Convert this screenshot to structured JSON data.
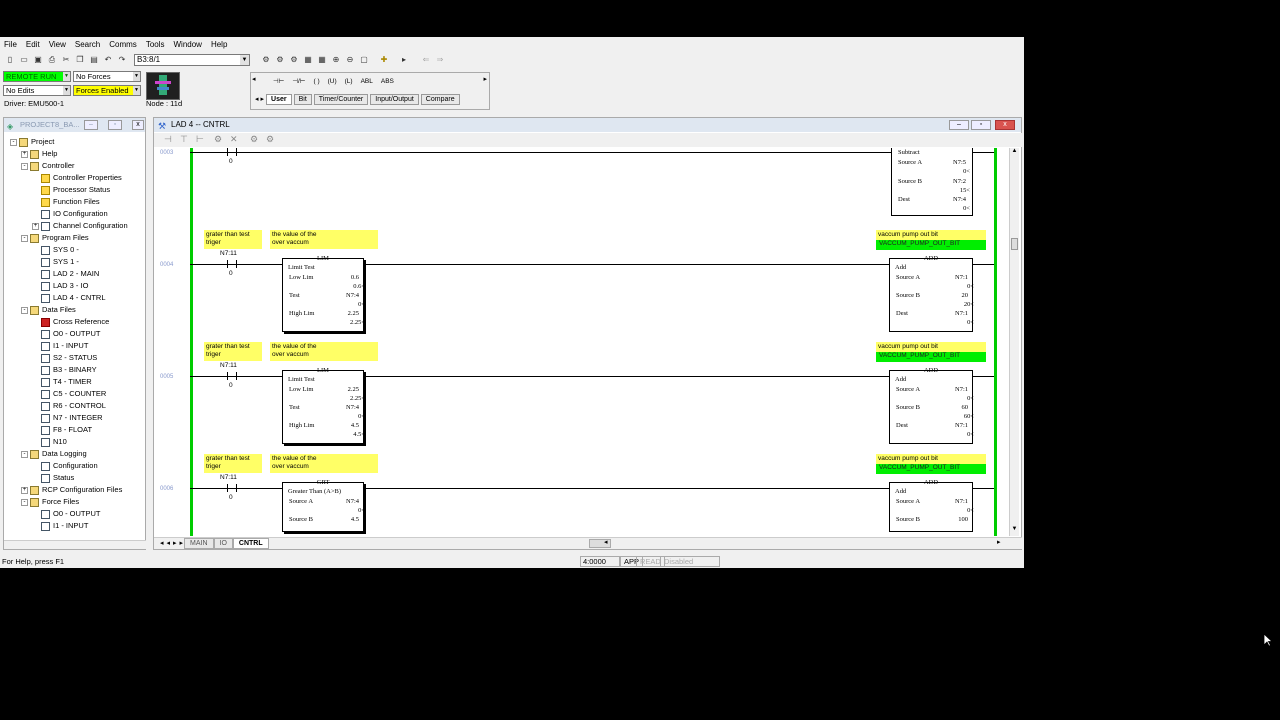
{
  "menu": [
    "File",
    "Edit",
    "View",
    "Search",
    "Comms",
    "Tools",
    "Window",
    "Help"
  ],
  "toolbar": {
    "address_combo": "B3:8/1"
  },
  "status_panel": {
    "mode": "REMOTE RUN",
    "forces": "No Forces",
    "edits": "No Edits",
    "forces_enabled": "Forces Enabled",
    "driver": "Driver: EMU500-1",
    "node": "Node : 11d"
  },
  "instruction_tabs": [
    "User",
    "Bit",
    "Timer/Counter",
    "Input/Output",
    "Compare"
  ],
  "instruction_row1": [
    "⊣⊢",
    "⊣/⊢",
    "( )",
    "(U)",
    "(L)",
    "ABL",
    "ABS"
  ],
  "project": {
    "title": "PROJECT8_BA...",
    "tree": [
      {
        "label": "Project",
        "lvl": 0,
        "icon": "folder",
        "exp": "-"
      },
      {
        "label": "Help",
        "lvl": 1,
        "icon": "folder",
        "exp": "+"
      },
      {
        "label": "Controller",
        "lvl": 1,
        "icon": "folder",
        "exp": "-"
      },
      {
        "label": "Controller Properties",
        "lvl": 2,
        "icon": "tool"
      },
      {
        "label": "Processor Status",
        "lvl": 2,
        "icon": "tool"
      },
      {
        "label": "Function Files",
        "lvl": 2,
        "icon": "tool"
      },
      {
        "label": "IO Configuration",
        "lvl": 2,
        "icon": "doc"
      },
      {
        "label": "Channel Configuration",
        "lvl": 2,
        "icon": "doc",
        "exp": "+"
      },
      {
        "label": "Program Files",
        "lvl": 1,
        "icon": "folder",
        "exp": "-"
      },
      {
        "label": "SYS 0 -",
        "lvl": 2,
        "icon": "doc"
      },
      {
        "label": "SYS 1 -",
        "lvl": 2,
        "icon": "doc"
      },
      {
        "label": "LAD 2 - MAIN",
        "lvl": 2,
        "icon": "doc"
      },
      {
        "label": "LAD 3 - IO",
        "lvl": 2,
        "icon": "doc"
      },
      {
        "label": "LAD 4 - CNTRL",
        "lvl": 2,
        "icon": "doc"
      },
      {
        "label": "Data Files",
        "lvl": 1,
        "icon": "folder",
        "exp": "-"
      },
      {
        "label": "Cross Reference",
        "lvl": 2,
        "icon": "red"
      },
      {
        "label": "O0 - OUTPUT",
        "lvl": 2,
        "icon": "doc"
      },
      {
        "label": "I1 - INPUT",
        "lvl": 2,
        "icon": "doc"
      },
      {
        "label": "S2 - STATUS",
        "lvl": 2,
        "icon": "doc"
      },
      {
        "label": "B3 - BINARY",
        "lvl": 2,
        "icon": "doc"
      },
      {
        "label": "T4 - TIMER",
        "lvl": 2,
        "icon": "doc"
      },
      {
        "label": "C5 - COUNTER",
        "lvl": 2,
        "icon": "doc"
      },
      {
        "label": "R6 - CONTROL",
        "lvl": 2,
        "icon": "doc"
      },
      {
        "label": "N7 - INTEGER",
        "lvl": 2,
        "icon": "doc"
      },
      {
        "label": "F8 - FLOAT",
        "lvl": 2,
        "icon": "doc"
      },
      {
        "label": "N10",
        "lvl": 2,
        "icon": "doc"
      },
      {
        "label": "Data Logging",
        "lvl": 1,
        "icon": "folder",
        "exp": "-"
      },
      {
        "label": "Configuration",
        "lvl": 2,
        "icon": "doc"
      },
      {
        "label": "Status",
        "lvl": 2,
        "icon": "doc"
      },
      {
        "label": "RCP Configuration Files",
        "lvl": 1,
        "icon": "folder",
        "exp": "+"
      },
      {
        "label": "Force Files",
        "lvl": 1,
        "icon": "folder",
        "exp": "-"
      },
      {
        "label": "O0 - OUTPUT",
        "lvl": 2,
        "icon": "doc"
      },
      {
        "label": "I1 - INPUT",
        "lvl": 2,
        "icon": "doc"
      }
    ]
  },
  "ladder": {
    "title": "LAD 4 -- CNTRL",
    "tabs": [
      "MAIN",
      "IO",
      "CNTRL"
    ],
    "top_subtract": {
      "title": "Subtract",
      "src_a": "N7:5",
      "src_a_val": "0<",
      "src_b": "N7:2",
      "src_b_val": "15<",
      "dest": "N7:4",
      "dest_val": "0<"
    },
    "rungs": [
      {
        "num": "0004",
        "cmt_contact": "grater than test\ntriger",
        "cmt_block": "the value of the\nover vaccum",
        "contact_addr": "N7:11",
        "contact_val": "0",
        "block": {
          "type": "LIM",
          "title": "Limit Test",
          "rows": [
            [
              "Low Lim",
              "0.6",
              "0.6<"
            ],
            [
              "Test",
              "N7:4",
              "0<"
            ],
            [
              "High Lim",
              "2.25",
              "2.25<"
            ]
          ]
        },
        "out_cmt": "vaccum pump  out bit",
        "out_tag": "VACCUM_PUMP_OUT_BIT",
        "out": {
          "type": "ADD",
          "title": "Add",
          "rows": [
            [
              "Source A",
              "N7:1",
              "0<"
            ],
            [
              "Source B",
              "20",
              "20<"
            ],
            [
              "Dest",
              "N7:1",
              "0<"
            ]
          ]
        }
      },
      {
        "num": "0005",
        "cmt_contact": "grater than test\ntriger",
        "cmt_block": "the value of the\nover vaccum",
        "contact_addr": "N7:11",
        "contact_val": "0",
        "block": {
          "type": "LIM",
          "title": "Limit Test",
          "rows": [
            [
              "Low Lim",
              "2.25",
              "2.25<"
            ],
            [
              "Test",
              "N7:4",
              "0<"
            ],
            [
              "High Lim",
              "4.5",
              "4.5<"
            ]
          ]
        },
        "out_cmt": "vaccum pump  out bit",
        "out_tag": "VACCUM_PUMP_OUT_BIT",
        "out": {
          "type": "ADD",
          "title": "Add",
          "rows": [
            [
              "Source A",
              "N7:1",
              "0<"
            ],
            [
              "Source B",
              "60",
              "60<"
            ],
            [
              "Dest",
              "N7:1",
              "0<"
            ]
          ]
        }
      },
      {
        "num": "0006",
        "cmt_contact": "grater than test\ntriger",
        "cmt_block": "the value of the\nover vaccum",
        "contact_addr": "N7:11",
        "contact_val": "0",
        "block": {
          "type": "GRT",
          "title": "Greater Than (A>B)",
          "rows": [
            [
              "Source A",
              "N7:4",
              "0<"
            ],
            [
              "Source B",
              "4.5",
              ""
            ]
          ]
        },
        "out_cmt": "vaccum pump  out bit",
        "out_tag": "VACCUM_PUMP_OUT_BIT",
        "out": {
          "type": "ADD",
          "title": "Add",
          "rows": [
            [
              "Source A",
              "N7:1",
              "0<"
            ],
            [
              "Source B",
              "100",
              ""
            ]
          ]
        }
      }
    ],
    "rung3_num": "0003",
    "rung3_val": "0"
  },
  "statusbar": {
    "help": "For Help, press F1",
    "addr": "4:0000",
    "app": "APP",
    "read": "READ",
    "disabled": "Disabled"
  },
  "colors": {
    "rail": "#00cc00",
    "comment": "#ffff66",
    "tag": "#00ee00",
    "remote_run": "#00ff00",
    "forces_enabled": "#ffff00"
  }
}
